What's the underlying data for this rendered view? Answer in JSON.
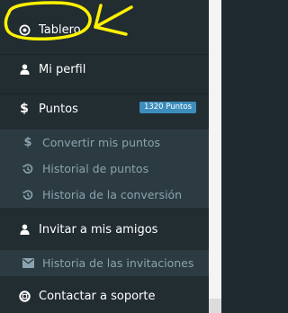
{
  "menu": {
    "dashboard": {
      "label": "Tablero",
      "icon": "target-icon"
    },
    "profile": {
      "label": "Mi perfil",
      "icon": "user-icon"
    },
    "points": {
      "label": "Puntos",
      "icon": "dollar-icon",
      "badge": "1320 Puntos"
    },
    "points_sub": [
      {
        "label": "Convertir mis puntos",
        "icon": "dollar-icon"
      },
      {
        "label": "Historial de puntos",
        "icon": "history-icon"
      },
      {
        "label": "Historia de la conversión",
        "icon": "history-icon"
      }
    ],
    "invite": {
      "label": "Invitar a mis amigos",
      "icon": "user-icon"
    },
    "invite_sub": [
      {
        "label": "Historia de las invitaciones",
        "icon": "envelope-icon"
      }
    ],
    "support": {
      "label": "Contactar a soporte",
      "icon": "lifebuoy-icon"
    }
  },
  "colors": {
    "sidebar_bg": "#222d32",
    "submenu_bg": "#2c3b41",
    "badge_bg": "#3c8dbc",
    "annotation": "#fff200"
  }
}
